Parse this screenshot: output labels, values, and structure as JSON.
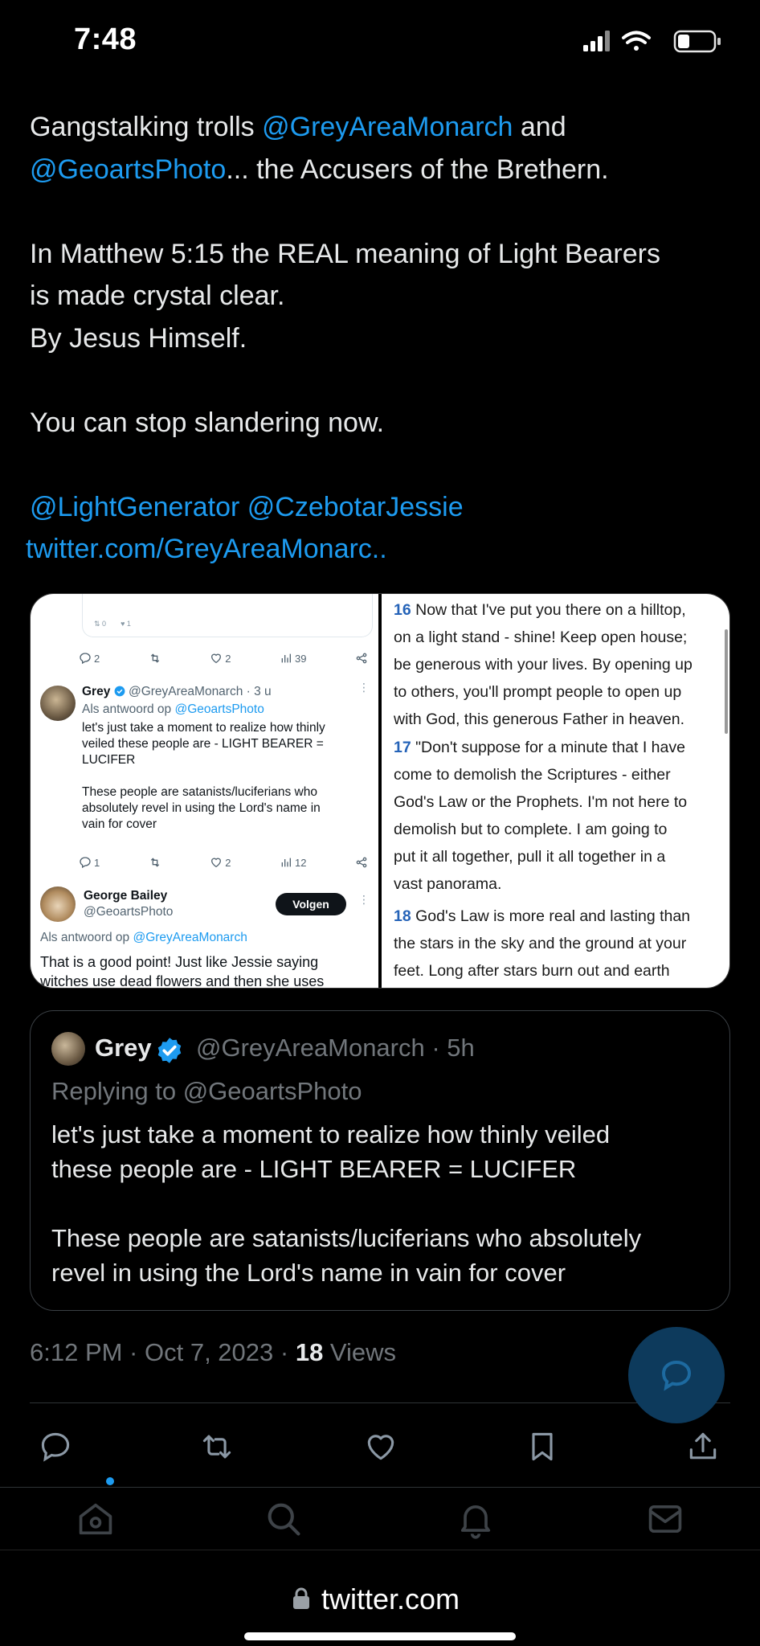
{
  "status_bar": {
    "time": "7:48"
  },
  "tweet": {
    "line1_prefix": "Gangstalking trolls ",
    "mention_grey": "@GreyAreaMonarch",
    "line1_suffix": " and",
    "mention_geoarts": "@GeoartsPhoto",
    "line2_suffix": "... the Accusers of the Brethern.",
    "line3": "In Matthew 5:15 the REAL meaning of Light Bearers",
    "line4": "is made crystal clear.",
    "line5": "By Jesus Himself.",
    "line6": "You can stop slandering now.",
    "mention_light": "@LightGenerator",
    "mention_czebotar": "@CzebotarJessie",
    "url": "twitter.com/GreyAreaMonarc.."
  },
  "media_left": {
    "top_counts": {
      "retweets": "0",
      "likes": "1"
    },
    "row1_counts": {
      "replies": "2",
      "likes": "2",
      "views": "39"
    },
    "tweet1": {
      "name": "Grey",
      "handle_time": "@GreyAreaMonarch · 3 u",
      "reply_prefix": "Als antwoord op ",
      "reply_to": "@GeoartsPhoto",
      "text1": "let's just take a moment to realize how thinly",
      "text2": "veiled these people are - LIGHT BEARER =",
      "text3": "LUCIFER",
      "text4": "These people are satanists/luciferians who",
      "text5": "absolutely revel in using the Lord's name in",
      "text6": "vain for cover"
    },
    "row2_counts": {
      "replies": "1",
      "likes": "2",
      "views": "12"
    },
    "tweet2": {
      "name": "George Bailey",
      "handle": "@GeoartsPhoto",
      "follow_button": "Volgen",
      "reply_prefix": "Als antwoord op ",
      "reply_to": "@GreyAreaMonarch",
      "text1": "That is a good point!  Just like Jessie saying",
      "text2": "witches use dead flowers and then she uses"
    }
  },
  "media_right": {
    "verses": [
      {
        "num": "16",
        "lines": [
          "Now that I've put you there on a hilltop,",
          "on a light stand - shine! Keep open house;",
          "be generous with your lives. By opening up",
          "to others, you'll prompt people to open up",
          "with God, this generous Father in heaven."
        ]
      },
      {
        "num": "17",
        "lines": [
          "\"Don't suppose for a minute that I have",
          "come to demolish the Scriptures - either",
          "God's Law or the Prophets. I'm not here to",
          "demolish but to complete. I am going to",
          "put it all together, pull it all together in a",
          "vast panorama."
        ]
      },
      {
        "num": "18",
        "lines": [
          "God's Law is more real and lasting than",
          "the stars in the sky and the ground at your",
          "feet. Long after stars burn out and earth"
        ]
      }
    ]
  },
  "quote": {
    "name": "Grey",
    "handle_time": "@GreyAreaMonarch · 5h",
    "replying_to": "Replying to @GeoartsPhoto",
    "line1": "let's just take a moment to realize how thinly veiled",
    "line2": "these people are - LIGHT BEARER = LUCIFER",
    "line3": "These people are satanists/luciferians who absolutely",
    "line4": "revel in using the Lord's name in vain for cover"
  },
  "meta": {
    "timestamp": "6:12 PM · Oct 7, 2023 · ",
    "views_count": "18",
    "views_label": " Views"
  },
  "actions": [
    "reply-icon",
    "retweet-icon",
    "like-icon",
    "bookmark-icon",
    "share-icon"
  ],
  "tabs": [
    "home-icon",
    "search-icon",
    "notifications-icon",
    "messages-icon"
  ],
  "browser": {
    "url": "twitter.com"
  },
  "colors": {
    "accent": "#1d9bf0",
    "text": "#e7e9ea",
    "muted": "#71767b",
    "background": "#000000"
  }
}
